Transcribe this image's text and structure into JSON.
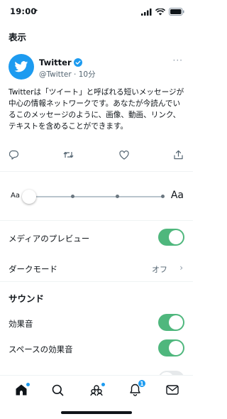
{
  "status_bar": {
    "time": "19:00"
  },
  "display_section": {
    "title": "表示"
  },
  "tweet": {
    "name": "Twitter",
    "handle_time": "@Twitter · 10分",
    "more": "···",
    "text": "Twitterは「ツイート」と呼ばれる短いメッセージが中心の情報ネットワークです。あなたが今読んでいるこのメッセージのように、画像、動画、リンク、テキストを含めることができます。"
  },
  "font_size": {
    "small_label": "Aa",
    "large_label": "Aa",
    "steps": 4,
    "selected_step": 1
  },
  "settings": {
    "media_preview": {
      "label": "メディアのプレビュー",
      "on": true
    },
    "dark_mode": {
      "label": "ダークモード",
      "value": "オフ"
    }
  },
  "sound_section": {
    "title": "サウンド",
    "sound_effects": {
      "label": "効果音",
      "on": true
    },
    "spaces_sound": {
      "label": "スペースの効果音",
      "on": true
    }
  },
  "tab_bar": {
    "notifications_badge": "1"
  },
  "colors": {
    "accent": "#1d9bf0",
    "toggle_on": "#4fb77d",
    "text": "#0f1419",
    "muted": "#536471"
  }
}
